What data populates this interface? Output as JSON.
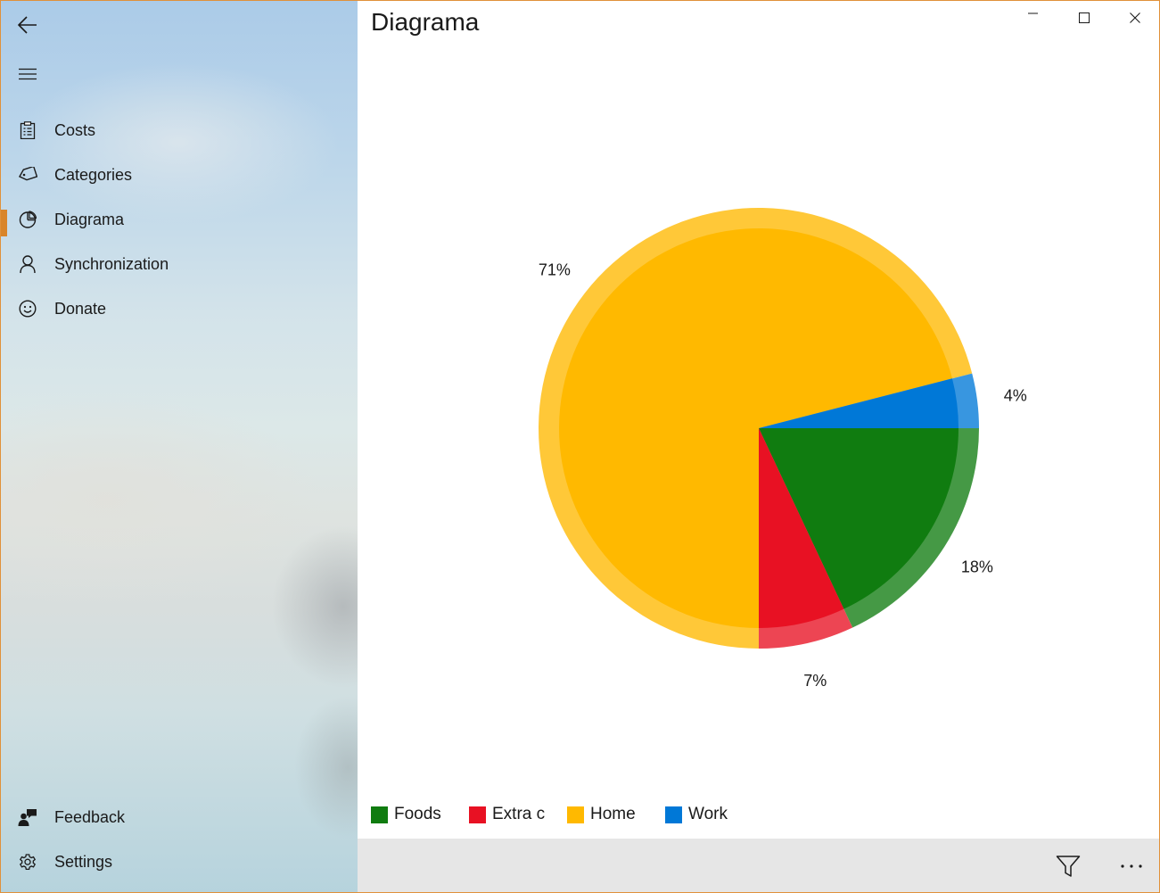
{
  "app": {
    "page_title": "Diagrama"
  },
  "sidebar": {
    "back_icon": "back-arrow-icon",
    "menu_icon": "hamburger-menu-icon",
    "items": [
      {
        "label": "Costs",
        "icon": "clipboard-list-icon",
        "selected": false
      },
      {
        "label": "Categories",
        "icon": "tag-icon",
        "selected": false
      },
      {
        "label": "Diagrama",
        "icon": "pie-chart-icon",
        "selected": true
      },
      {
        "label": "Synchronization",
        "icon": "person-icon",
        "selected": false
      },
      {
        "label": "Donate",
        "icon": "smiley-icon",
        "selected": false
      }
    ],
    "footer_items": [
      {
        "label": "Feedback",
        "icon": "feedback-person-icon"
      },
      {
        "label": "Settings",
        "icon": "gear-icon"
      }
    ],
    "accent_color": "#d9852a"
  },
  "window_controls": [
    "minimize-icon",
    "maximize-icon",
    "close-icon"
  ],
  "chart_data": {
    "type": "pie",
    "slices": [
      {
        "name": "Foods",
        "percent": 18,
        "label": "18%",
        "color": "#107c10"
      },
      {
        "name": "Extra c",
        "percent": 7,
        "label": "7%",
        "color": "#e81123"
      },
      {
        "name": "Home",
        "percent": 71,
        "label": "71%",
        "color": "#ffb900"
      },
      {
        "name": "Work",
        "percent": 4,
        "label": "4%",
        "color": "#0078d7"
      }
    ],
    "legend_position": "bottom-left"
  },
  "command_bar": {
    "filter_icon": "filter-icon",
    "more_icon": "more-ellipsis-icon"
  }
}
